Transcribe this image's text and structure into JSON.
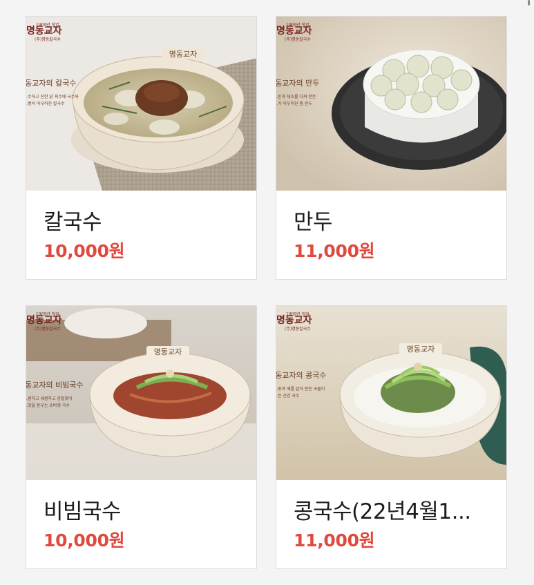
{
  "brand": {
    "tagline": "1969년 창업",
    "name": "명동교자",
    "company": "(주)명동칼국수",
    "bowl_mark": "명동교자"
  },
  "menu": [
    {
      "name": "칼국수",
      "price": "10,000원",
      "image_caption": "명동교자의 칼국수",
      "caption_line1": "…수하고 진한 닭 육수에 국수와",
      "caption_line2": "…병이 어우러진 칼국수"
    },
    {
      "name": "만두",
      "price": "11,000원",
      "image_caption": "명동교자의 만두",
      "caption_line1": "…돈과 채소를 다져 만든",
      "caption_line2": "…가 어우러진 찜 만두"
    },
    {
      "name": "비빔국수",
      "price": "10,000원",
      "image_caption": "명동교자의 비빔국수",
      "caption_line1": "…콤하고 새콤하고 감칠맛이",
      "caption_line2": "…맛을 돋우는 소바형 국수"
    },
    {
      "name": "콩국수(22년4월1...",
      "price": "11,000원",
      "image_caption": "명동교자의 콩국수",
      "caption_line1": "…콩과 깨를 갈아 만든 국물이",
      "caption_line2": "…은 건강 국수"
    }
  ],
  "colors": {
    "price": "#e0493d",
    "name": "#1d1d1d",
    "background": "#f4f4f5",
    "card_border": "#dcdcdc"
  }
}
